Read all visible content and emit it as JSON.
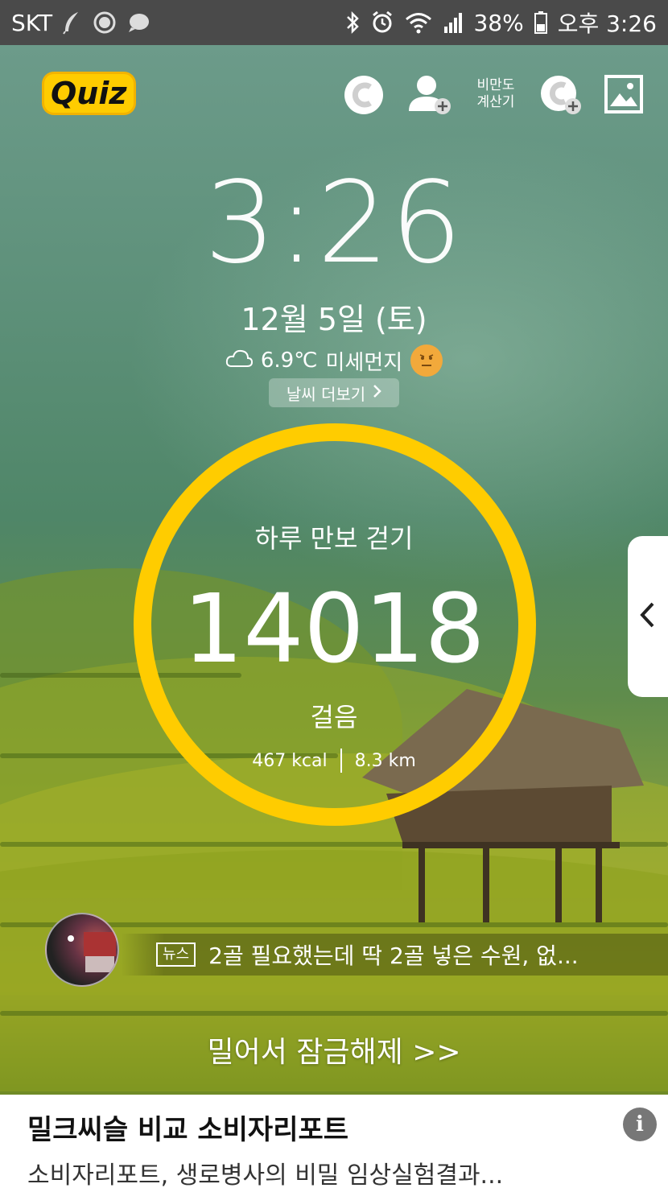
{
  "status_bar": {
    "carrier": "SKT",
    "battery": "38%",
    "time": "오후 3:26",
    "icons": [
      "feather-icon",
      "circle-icon",
      "chat-bubble-icon",
      "bluetooth-icon",
      "alarm-icon",
      "wifi-icon",
      "signal-icon",
      "battery-icon"
    ]
  },
  "top_bar": {
    "quiz_label": "Quiz",
    "diet_calc_label": "비만도\n계산기",
    "icons": [
      "cashslide-coin-icon",
      "add-user-icon",
      "coin-plus-icon",
      "image-icon"
    ]
  },
  "clock": {
    "time": "3:26",
    "date": "12월 5일 (토)"
  },
  "weather": {
    "temp": "6.9℃",
    "dust_label": "미세먼지",
    "more_label": "날씨 더보기",
    "icon": "cloud-icon",
    "dust_icon": "frown-face-icon"
  },
  "steps": {
    "title": "하루 만보 걷기",
    "count": "14018",
    "unit": "걸음",
    "kcal": "467 kcal",
    "distance": "8.3 km",
    "ring_color": "#ffcc00"
  },
  "news": {
    "tag": "뉴스",
    "headline": "2골 필요했는데 딱 2골 넣은 수원, 없..."
  },
  "unlock": {
    "label": "밀어서 잠금해제 >>"
  },
  "ad": {
    "title": "밀크씨슬 비교 소비자리포트",
    "description": "소비자리포트, 생로병사의 비밀 임상실험결과...",
    "info_label": "i"
  }
}
